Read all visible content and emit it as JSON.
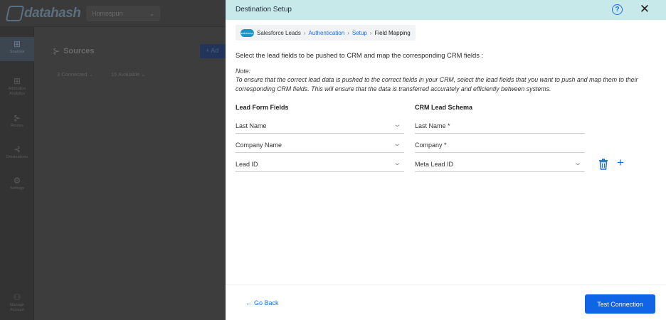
{
  "app": {
    "logo_text": "datahash",
    "workspace": "Homespun",
    "sidebar": [
      {
        "label": "Sources",
        "icon": "grid-icon"
      },
      {
        "label": "Attribution Analytics",
        "icon": "grid-icon"
      },
      {
        "label": "Routes",
        "icon": "route-icon"
      },
      {
        "label": "Destinations",
        "icon": "route-icon"
      },
      {
        "label": "Settings",
        "icon": "gear-icon"
      },
      {
        "label": "Manage Account",
        "icon": "users-icon"
      }
    ],
    "page_title": "Sources",
    "add_button": "+ Ad",
    "filters": [
      "3 Connected ⌄",
      "15 Available ⌄"
    ]
  },
  "panel": {
    "title": "Destination Setup",
    "help": "?",
    "close": "✕",
    "breadcrumb": {
      "source": "Salesforce Leads",
      "steps": [
        "Authentication",
        "Setup"
      ],
      "current": "Field Mapping",
      "separator": "›",
      "cloud_text": "salesforce"
    },
    "instruction": "Select the lead fields to be pushed to CRM and map the corresponding CRM fields :",
    "note_label": "Note:",
    "note_text": "To ensure that the correct lead data is pushed to the correct fields in your CRM, select the lead fields that you want to push and map them to their corresponding CRM fields. This will ensure that the data is transferred accurately and efficiently between systems.",
    "lead_header": "Lead Form Fields",
    "crm_header": "CRM Lead Schema",
    "mappings": [
      {
        "lead": "Last Name",
        "crm": "Last Name *"
      },
      {
        "lead": "Company Name",
        "crm": "Company *"
      },
      {
        "lead": "Lead ID",
        "crm": "Meta Lead ID"
      }
    ],
    "chevron": "⌄",
    "plus": "+",
    "go_back": "Go Back",
    "go_back_arrow": "←",
    "test_connection": "Test Connection",
    "colors": {
      "header_bg": "#c7e9ea",
      "accent": "#1c6fe0",
      "button_bg": "#0f65e6"
    }
  }
}
